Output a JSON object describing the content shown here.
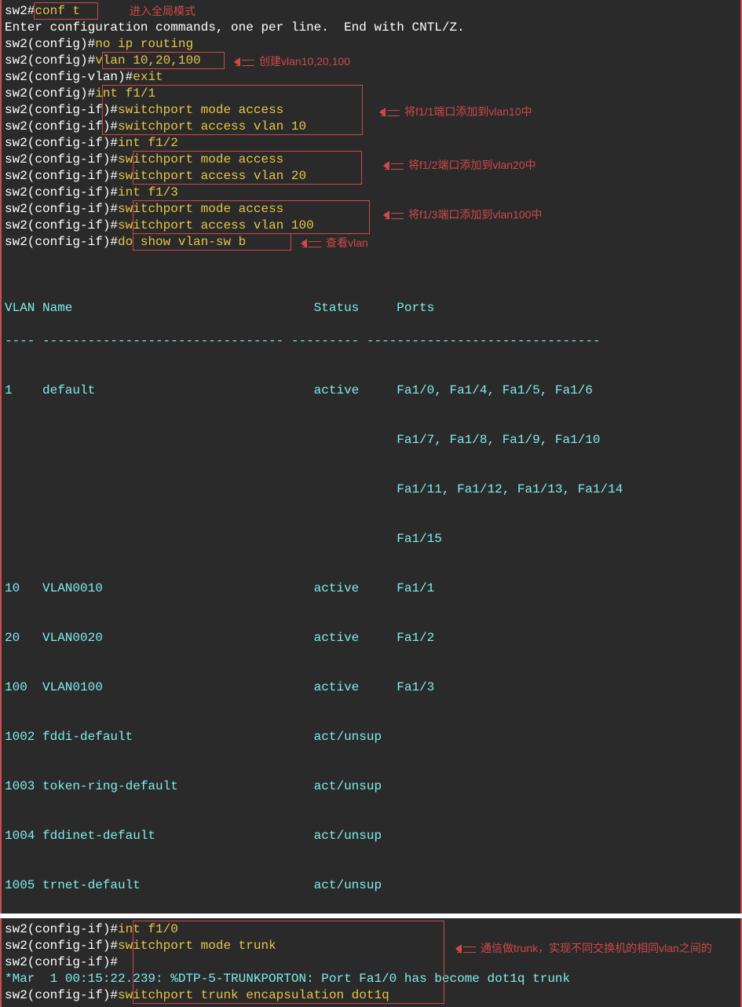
{
  "t": {
    "l1_prompt": "sw2#",
    "l1_cmd": "conf t",
    "l2": "Enter configuration commands, one per line.  End with CNTL/Z.",
    "l3_prompt": "sw2(config)#",
    "l3_cmd": "no ip routing",
    "l4_prompt": "sw2(config)#",
    "l4_cmd": "vlan 10,20,100",
    "l5_prompt": "sw2(config-vlan)#",
    "l5_cmd": "exit",
    "l6_prompt": "sw2(config)#",
    "l6_cmd": "int f1/1",
    "l7_prompt": "sw2(config-if)#",
    "l7_cmd": "switchport mode access",
    "l8_prompt": "sw2(config-if)#",
    "l8_cmd": "switchport access vlan 10",
    "l9_prompt": "sw2(config-if)#",
    "l9_cmd": "int f1/2",
    "l10_prompt": "sw2(config-if)#",
    "l10_cmd": "switchport mode access",
    "l11_prompt": "sw2(config-if)#",
    "l11_cmd": "switchport access vlan 20",
    "l12_prompt": "sw2(config-if)#",
    "l12_cmd": "int f1/3",
    "l13_prompt": "sw2(config-if)#",
    "l13_cmd": "switchport mode access",
    "l14_prompt": "sw2(config-if)#",
    "l14_cmd": "switchport access vlan 100",
    "l15_prompt": "sw2(config-if)#",
    "l15_cmd": "do show vlan-sw b"
  },
  "anno": {
    "global": "进入全局模式",
    "vlan": "创建vlan10,20,100",
    "v10": "将f1/1端口添加到vlan10中",
    "v20": "将f1/2端口添加到vlan20中",
    "v100": "将f1/3端口添加到vlan100中",
    "show": "查看vlan",
    "trunk": "通信做trunk，实现不同交换机的相同vlan之间的"
  },
  "table": {
    "hdr_vlan": "VLAN",
    "hdr_name": "Name",
    "hdr_stat": "Status",
    "hdr_ports": "Ports",
    "sep": "---- -------------------------------- --------- -------------------------------",
    "r1_id": "1",
    "r1_name": "default",
    "r1_stat": "active",
    "r1_ports1": "Fa1/0, Fa1/4, Fa1/5, Fa1/6",
    "r1_ports2": "Fa1/7, Fa1/8, Fa1/9, Fa1/10",
    "r1_ports3": "Fa1/11, Fa1/12, Fa1/13, Fa1/14",
    "r1_ports4": "Fa1/15",
    "r2_id": "10",
    "r2_name": "VLAN0010",
    "r2_stat": "active",
    "r2_ports": "Fa1/1",
    "r3_id": "20",
    "r3_name": "VLAN0020",
    "r3_stat": "active",
    "r3_ports": "Fa1/2",
    "r4_id": "100",
    "r4_name": "VLAN0100",
    "r4_stat": "active",
    "r4_ports": "Fa1/3",
    "r5_id": "1002",
    "r5_name": "fddi-default",
    "r5_stat": "act/unsup",
    "r5_ports": "",
    "r6_id": "1003",
    "r6_name": "token-ring-default",
    "r6_stat": "act/unsup",
    "r6_ports": "",
    "r7_id": "1004",
    "r7_name": "fddinet-default",
    "r7_stat": "act/unsup",
    "r7_ports": "",
    "r8_id": "1005",
    "r8_name": "trnet-default",
    "r8_stat": "act/unsup",
    "r8_ports": ""
  },
  "b": {
    "l1_prompt": "sw2(config-if)#",
    "l1_cmd": "int f1/0",
    "l2_prompt": "sw2(config-if)#",
    "l2_cmd": "switchport mode trunk",
    "l3_prompt": "sw2(config-if)#",
    "l3_cmd": "",
    "l4": "*Mar  1 00:15:22.239: %DTP-5-TRUNKPORTON: Port Fa1/0 has become dot1q trunk",
    "l5_prompt": "sw2(config-if)#",
    "l5_cmd": "switchport trunk encapsulation dot1q"
  }
}
